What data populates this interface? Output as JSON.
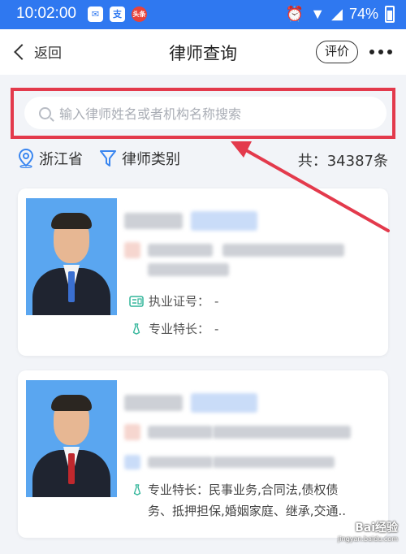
{
  "status_bar": {
    "time": "10:02:00",
    "notification_icons": [
      "mail-icon",
      "alipay-icon",
      "toutiao-icon"
    ],
    "toutiao_text": "头条",
    "alipay_text": "支",
    "battery": "74%"
  },
  "nav": {
    "back_label": "返回",
    "title": "律师查询",
    "rate_label": "评价"
  },
  "search": {
    "placeholder": "输入律师姓名或者机构名称搜索"
  },
  "filters": {
    "region": "浙江省",
    "category": "律师类别",
    "count": "共：34387条"
  },
  "cards": [
    {
      "license_label": "执业证号：",
      "license_value": "-",
      "specialty_label": "专业特长：",
      "specialty_value": "-",
      "org_suffix": "…法律局",
      "tie_color": "#3a6fd0"
    },
    {
      "specialty_text_line1": "专业特长：民事业务,合同法,债权债",
      "specialty_text_line2": "务、抵押担保,婚姻家庭、继承,交通..",
      "tie_color": "#c0282d"
    }
  ],
  "watermark": {
    "brand": "Bai经验",
    "url": "jingyan.baidu.com"
  },
  "colors": {
    "accent": "#2f78f0",
    "annotation": "#e33a4c"
  }
}
